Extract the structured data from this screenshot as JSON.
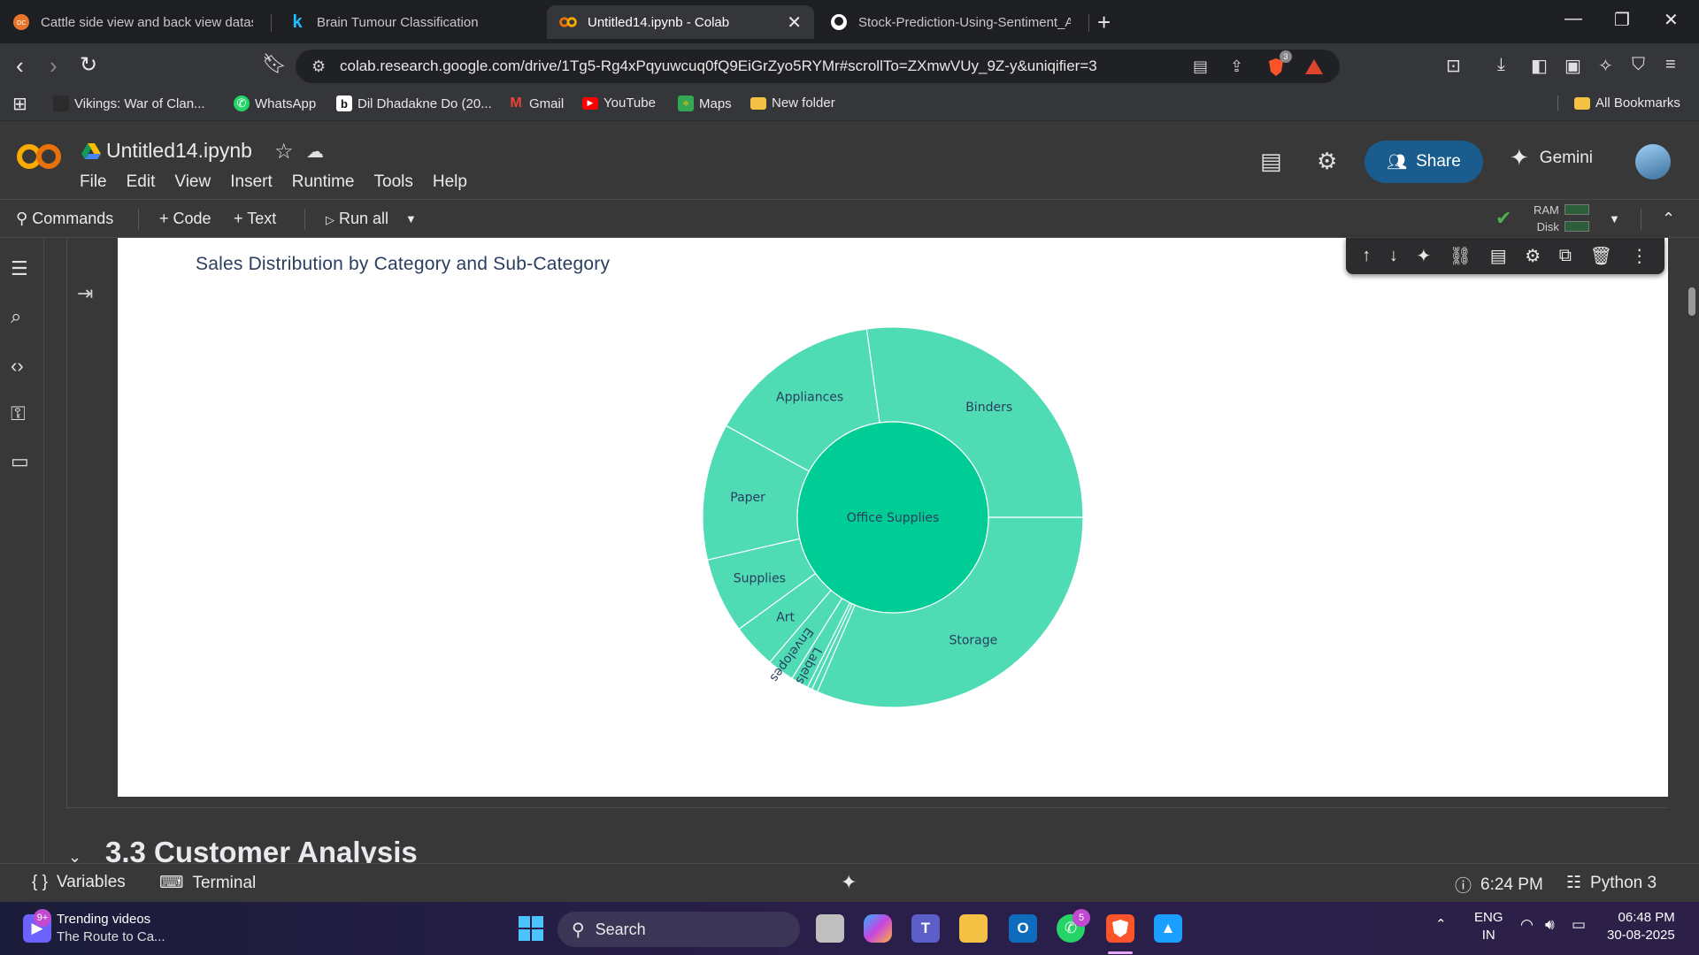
{
  "browser": {
    "tabs": [
      {
        "label": "Cattle side view and back view datase",
        "icon": "dataset-favicon",
        "active": false
      },
      {
        "label": "Brain Tumour Classification",
        "icon": "kaggle-favicon",
        "active": false
      },
      {
        "label": "Untitled14.ipynb - Colab",
        "icon": "colab-favicon",
        "active": true
      },
      {
        "label": "Stock-Prediction-Using-Sentiment_A",
        "icon": "github-favicon",
        "active": false
      }
    ],
    "url": "colab.research.google.com/drive/1Tg5-Rg4xPqyuwcuq0fQ9EiGrZyo5RYMr#scrollTo=ZXmwVUy_9Z-y&uniqifier=3",
    "shield_count": "3",
    "bookmarks": [
      {
        "label": "Vikings: War of Clan...",
        "icon": "vikings-icon"
      },
      {
        "label": "WhatsApp",
        "icon": "whatsapp-icon"
      },
      {
        "label": "Dil Dhadakne Do (20...",
        "icon": "movie-icon"
      },
      {
        "label": "Gmail",
        "icon": "gmail-icon"
      },
      {
        "label": "YouTube",
        "icon": "youtube-icon"
      },
      {
        "label": "Maps",
        "icon": "maps-icon"
      },
      {
        "label": "New folder",
        "icon": "folder-icon"
      }
    ],
    "all_bookmarks": "All Bookmarks"
  },
  "colab": {
    "notebook_title": "Untitled14.ipynb",
    "menu": [
      "File",
      "Edit",
      "View",
      "Insert",
      "Runtime",
      "Tools",
      "Help"
    ],
    "share_label": "Share",
    "gemini_label": "Gemini",
    "toolbar": {
      "commands": "Commands",
      "code": "+ Code",
      "text": "+ Text",
      "run_all": "Run all",
      "ram": "RAM",
      "disk": "Disk"
    },
    "section_heading": "3.3 Customer Analysis",
    "status": {
      "variables": "Variables",
      "terminal": "Terminal",
      "time": "6:24 PM",
      "kernel": "Python 3"
    }
  },
  "chart_data": {
    "type": "sunburst",
    "title": "Sales Distribution by Category and Sub-Category",
    "colors": {
      "root": "#00cc96",
      "leaf": "#4fdbb4",
      "border": "#ffffff"
    },
    "root": {
      "label": "Office Supplies",
      "value": 100
    },
    "children": [
      {
        "label": "Storage",
        "value": 31.5
      },
      {
        "label": "",
        "value": 0.5
      },
      {
        "label": "",
        "value": 0.4
      },
      {
        "label": "Labels",
        "value": 1.5
      },
      {
        "label": "Envelopes",
        "value": 2.3
      },
      {
        "label": "Art",
        "value": 3.8
      },
      {
        "label": "Supplies",
        "value": 6.4
      },
      {
        "label": "Paper",
        "value": 11.6
      },
      {
        "label": "Appliances",
        "value": 14.8
      },
      {
        "label": "Binders",
        "value": 27.2
      }
    ]
  },
  "taskbar": {
    "widget_title": "Trending videos",
    "widget_subtitle": "The Route to Ca...",
    "widget_badge": "9+",
    "search": "Search",
    "whatsapp_badge": "5",
    "lang_top": "ENG",
    "lang_bottom": "IN",
    "time": "06:48 PM",
    "date": "30-08-2025"
  }
}
